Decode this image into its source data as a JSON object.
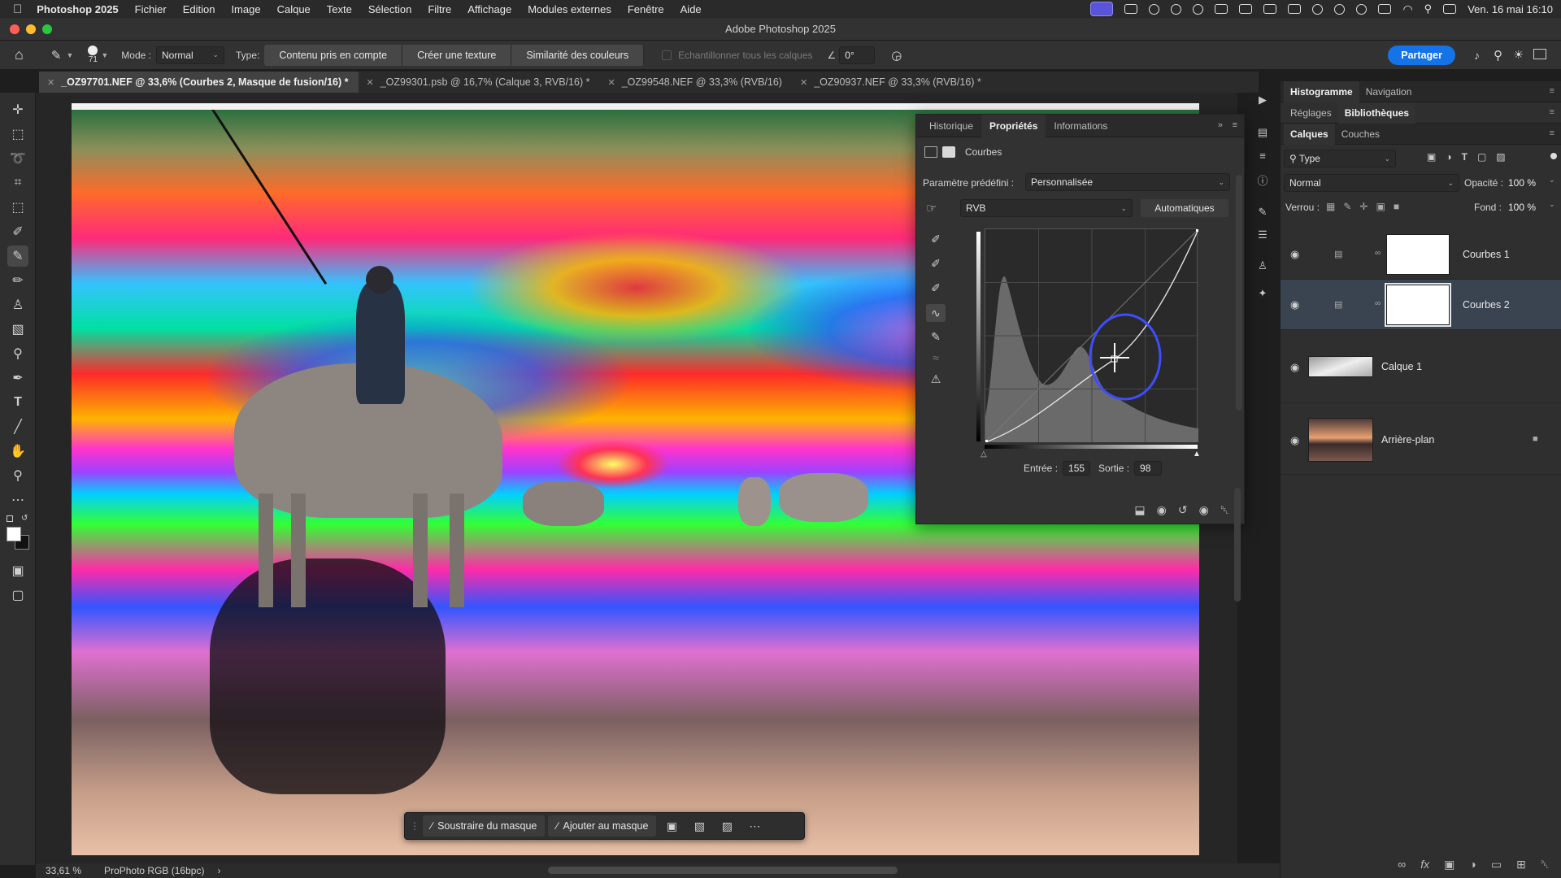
{
  "menubar": {
    "app_name": "Photoshop 2025",
    "items": [
      "Fichier",
      "Edition",
      "Image",
      "Calque",
      "Texte",
      "Sélection",
      "Filtre",
      "Affichage",
      "Modules externes",
      "Fenêtre",
      "Aide"
    ],
    "clock": "Ven. 16 mai  16:10"
  },
  "window": {
    "title": "Adobe Photoshop 2025"
  },
  "options": {
    "brush_size": "71",
    "mode_label": "Mode :",
    "mode_value": "Normal",
    "type_label": "Type:",
    "type_buttons": [
      "Contenu pris en compte",
      "Créer une texture",
      "Similarité des couleurs"
    ],
    "sample_all": "Echantillonner tous les calques",
    "angle": "0°",
    "share_label": "Partager"
  },
  "tabs": [
    {
      "label": "_OZ97701.NEF @ 33,6% (Courbes 2, Masque de fusion/16) *",
      "active": true
    },
    {
      "label": "_OZ99301.psb @ 16,7% (Calque 3, RVB/16) *",
      "active": false
    },
    {
      "label": "_OZ99548.NEF @ 33,3% (RVB/16)",
      "active": false
    },
    {
      "label": "_OZ90937.NEF @ 33,3% (RVB/16) *",
      "active": false
    }
  ],
  "properties": {
    "tabs": [
      "Historique",
      "Propriétés",
      "Informations"
    ],
    "active_tab": "Propriétés",
    "adjustment_name": "Courbes",
    "preset_label": "Paramètre prédéfini :",
    "preset_value": "Personnalisée",
    "channel": "RVB",
    "auto_button": "Automatiques",
    "input_label": "Entrée :",
    "input_value": "155",
    "output_label": "Sortie :",
    "output_value": "98"
  },
  "right_panels": {
    "top_tabs": [
      "Histogramme",
      "Navigation"
    ],
    "mid_tabs": [
      "Réglages",
      "Bibliothèques"
    ],
    "layer_tabs": [
      "Calques",
      "Couches"
    ],
    "filter_label": "Type",
    "blend_mode": "Normal",
    "opacity_label": "Opacité :",
    "opacity_value": "100 %",
    "lock_label": "Verrou :",
    "fill_label": "Fond :",
    "fill_value": "100 %",
    "layers": [
      {
        "name": "Courbes 1",
        "selected": false
      },
      {
        "name": "Courbes 2",
        "selected": true
      },
      {
        "name": "Calque 1",
        "selected": false
      },
      {
        "name": "Arrière-plan",
        "selected": false
      }
    ]
  },
  "taskbar": {
    "subtract": "Soustraire du masque",
    "add": "Ajouter au masque"
  },
  "status": {
    "zoom": "33,61 %",
    "profile": "ProPhoto RGB (16bpc)"
  },
  "colors": {
    "accent": "#1473e6",
    "selection": "#3a4350",
    "curve_handle": "#3d4dff"
  }
}
